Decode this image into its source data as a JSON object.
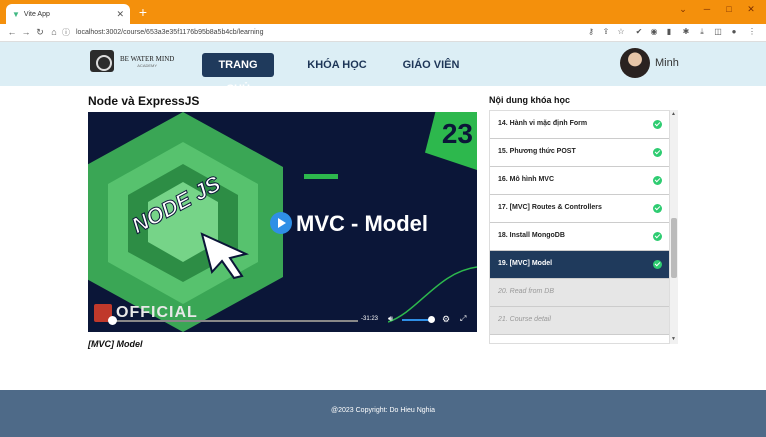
{
  "browser": {
    "tab_title": "Vite App",
    "url": "localhost:3002/course/653a3e35f1176b95b8a5b4cb/learning"
  },
  "header": {
    "logo_text": "BE WATER MIND",
    "logo_sub": "ACADEMY",
    "nav": [
      "TRANG CHỦ",
      "KHÓA HỌC",
      "GIÁO VIÊN"
    ],
    "username": "Minh"
  },
  "course": {
    "title": "Node và ExpressJS",
    "caption": "[MVC] Model"
  },
  "video": {
    "episode": "23",
    "headline": "MVC - Model",
    "brand": "OFFICIAL",
    "time_remaining": "-31:23",
    "progress": 0.02,
    "volume": 0.85
  },
  "sidebar": {
    "title": "Nội dung khóa học",
    "lessons": [
      {
        "label": "14. Hành vi mặc định Form",
        "state": "done"
      },
      {
        "label": "15. Phương thức POST",
        "state": "done"
      },
      {
        "label": "16. Mô hình MVC",
        "state": "done"
      },
      {
        "label": "17. [MVC] Routes & Controllers",
        "state": "done"
      },
      {
        "label": "18. Install MongoDB",
        "state": "done"
      },
      {
        "label": "19. [MVC] Model",
        "state": "active"
      },
      {
        "label": "20. Read from DB",
        "state": "locked"
      },
      {
        "label": "21. Course detail",
        "state": "locked"
      }
    ]
  },
  "footer": {
    "copyright": "@2023 Copyright: Do Hieu Nghia"
  }
}
